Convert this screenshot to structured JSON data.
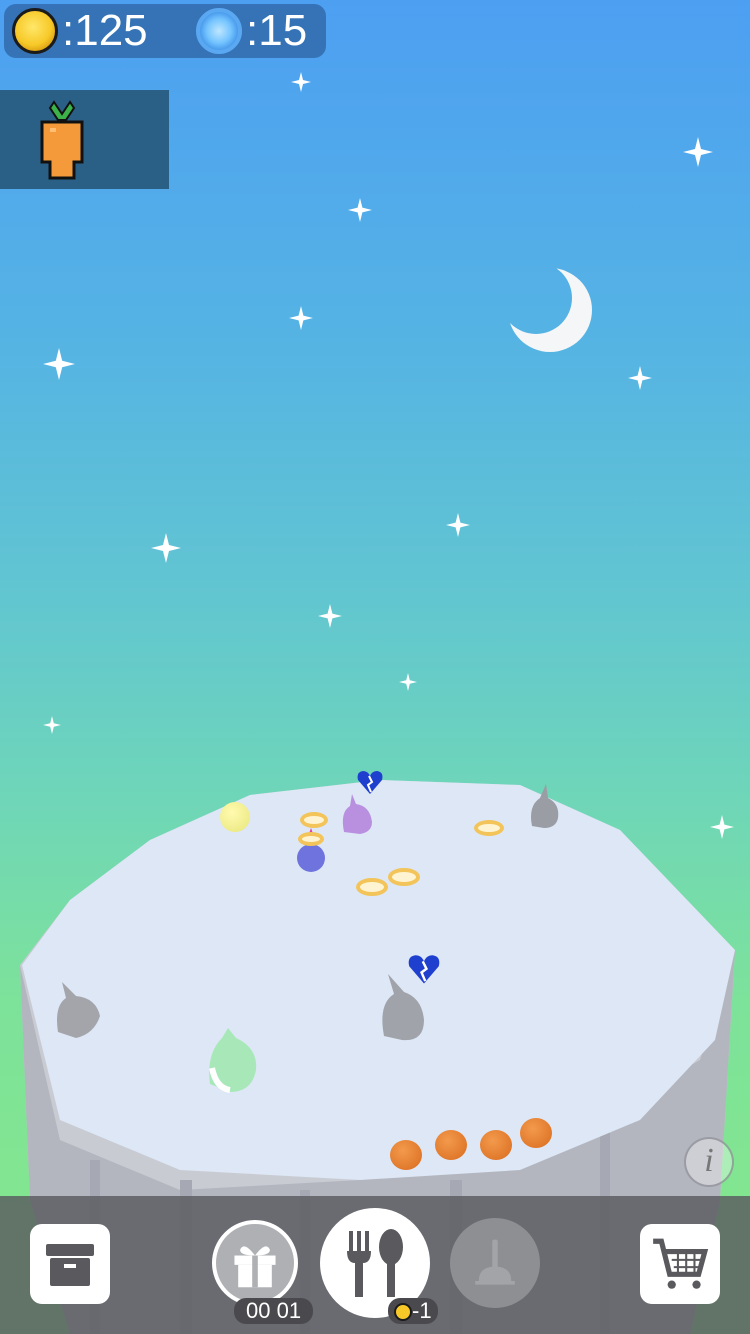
{
  "hud": {
    "coins_text": ":125",
    "gems_text": ":15",
    "coin_icon": "gold-coin-icon",
    "gem_icon": "blue-gem-icon"
  },
  "inventory": {
    "selected_item_icon": "carrot-icon"
  },
  "scene": {
    "sky_colors": [
      "#4d9ff2",
      "#62c6d0",
      "#86e88a"
    ],
    "moon_icon": "crescent-moon-icon",
    "creatures": [
      "gray-rabbit",
      "green-rabbit",
      "gray-rabbit",
      "purple-rabbit",
      "blue-rabbit",
      "gray-rabbit",
      "yellow-chick"
    ],
    "heart_icon": "broken-heart-icon",
    "food_items": [
      "donut",
      "donut",
      "donut",
      "donut",
      "donut",
      "orange",
      "orange",
      "orange",
      "orange"
    ]
  },
  "toolbar": {
    "storage_icon": "storage-box-icon",
    "gift_icon": "gift-icon",
    "gift_timer": "00 01",
    "feed_icon": "fork-spoon-icon",
    "feed_cost": "-1",
    "clean_icon": "plunger-icon",
    "shop_icon": "shopping-cart-icon",
    "info_label": "i"
  }
}
